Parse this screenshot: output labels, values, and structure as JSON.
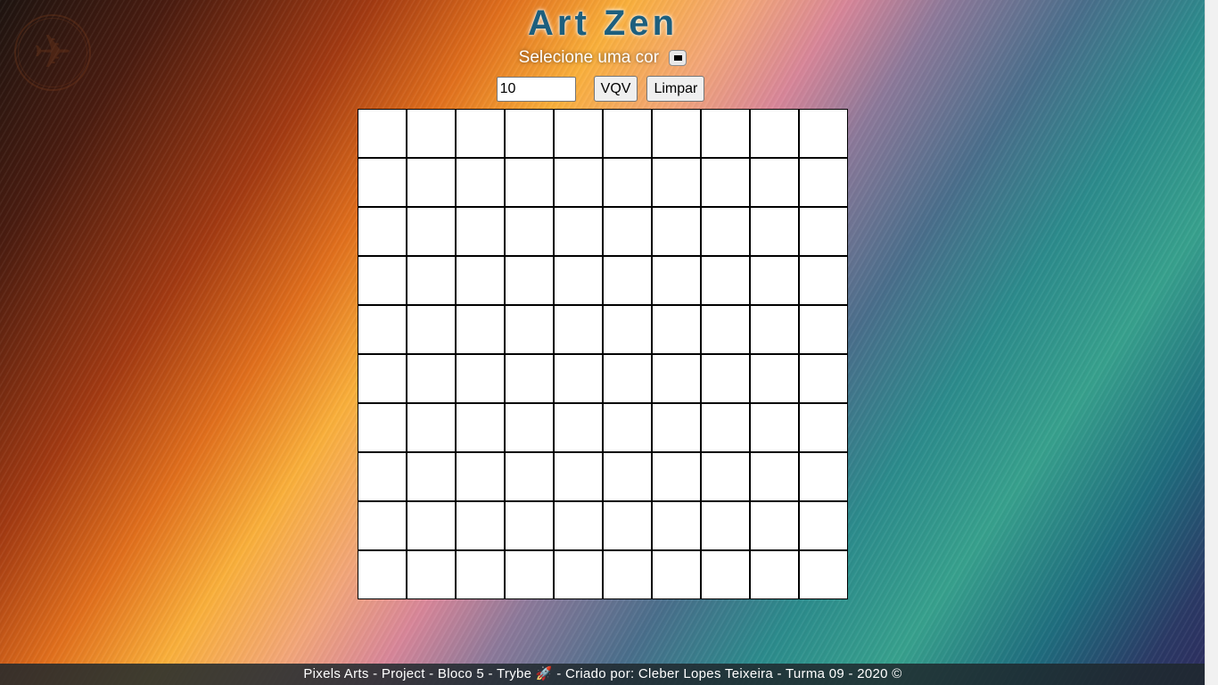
{
  "header": {
    "title": "Art Zen",
    "logo_icon": "airplane-icon"
  },
  "palette": {
    "label": "Selecione uma cor",
    "selected_color": "#000000"
  },
  "controls": {
    "board_size_value": "10",
    "generate_label": "VQV",
    "clear_label": "Limpar"
  },
  "board": {
    "rows": 10,
    "columns": 10,
    "cell_color": "#ffffff"
  },
  "footer": {
    "text": "Pixels Arts - Project - Bloco 5 - Trybe 🚀 - Criado por: Cleber Lopes Teixeira - Turma 09 - 2020 ©"
  }
}
